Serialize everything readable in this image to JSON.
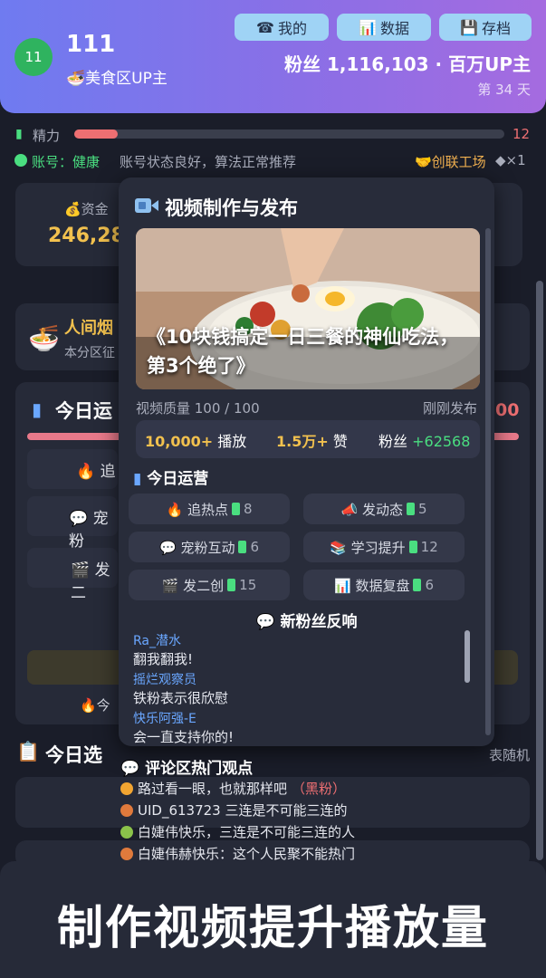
{
  "header": {
    "level": "11",
    "username": "111",
    "zone": "🍜美食区UP主",
    "buttons": [
      {
        "label": "我的",
        "icon": "☎"
      },
      {
        "label": "数据",
        "icon": "📊"
      },
      {
        "label": "存档",
        "icon": "💾"
      }
    ],
    "fans_line": "粉丝 1,116,103 · 百万UP主",
    "day": "第 34 天"
  },
  "status": {
    "energy_label": "精力",
    "energy_value": "12",
    "energy_level": 0.1,
    "account_line": "账号：健康",
    "account_desc": "账号状态良好，算法正常推荐",
    "guild": "🤝创联工场",
    "gems": "◆×1"
  },
  "background": {
    "funds_label": "💰资金",
    "funds_value": "246,28",
    "event_title": "人间烟",
    "event_desc": "本分区征",
    "today_ops_partial": "今日运",
    "partial_value": "00",
    "btn_hot_partial": "🔥 追",
    "btn_fans_partial": "💬 宠粉",
    "btn_remix_partial": "🎬 发二",
    "today_bottom": "🔥今",
    "today_choice": "今日选",
    "random_text": "表随机"
  },
  "modal": {
    "title": "视频制作与发布",
    "video_caption": "《10块钱搞定一日三餐的神仙吃法，第3个绝了》",
    "quality": "视频质量 100 / 100",
    "published": "刚刚发布",
    "plays_value": "10,000+",
    "plays_label": "播放",
    "likes_value": "1.5万+",
    "likes_label": "赞",
    "fans_label": "粉丝",
    "fans_gain": "+62568",
    "ops_title": "今日运营",
    "ops": [
      {
        "label": "🔥 追热点",
        "count": "8"
      },
      {
        "label": "📣 发动态",
        "count": "5"
      },
      {
        "label": "💬 宠粉互动",
        "count": "6"
      },
      {
        "label": "📚 学习提升",
        "count": "12"
      },
      {
        "label": "🎬 发二创",
        "count": "15"
      },
      {
        "label": "📊 数据复盘",
        "count": "6"
      }
    ],
    "reactions_title": "💬 新粉丝反响",
    "reactions": [
      {
        "name": "Ra_潜水",
        "text": "翻我翻我!"
      },
      {
        "name": "摇烂观察员",
        "text": "铁粉表示很欣慰"
      },
      {
        "name": "快乐阿强-E",
        "text": "会一直支持你的!"
      }
    ]
  },
  "comments": {
    "title": "💬 评论区热门观点",
    "items": [
      {
        "text": "路过看一眼，也就那样吧",
        "tag": "（黑粉）",
        "dot_color": "#f2a531"
      },
      {
        "text": "UID_613723 三连是不可能三连的",
        "tag": "",
        "dot_color": "#e07a3c"
      },
      {
        "text": "白婕伟快乐，三连是不可能三连的人",
        "tag": "",
        "dot_color": "#8bc34a"
      },
      {
        "text": "白婕伟赫快乐：这个人民聚不能热门",
        "tag": "",
        "dot_color": "#e07a3c"
      }
    ]
  },
  "banner": {
    "text": "制作视频提升播放量"
  }
}
